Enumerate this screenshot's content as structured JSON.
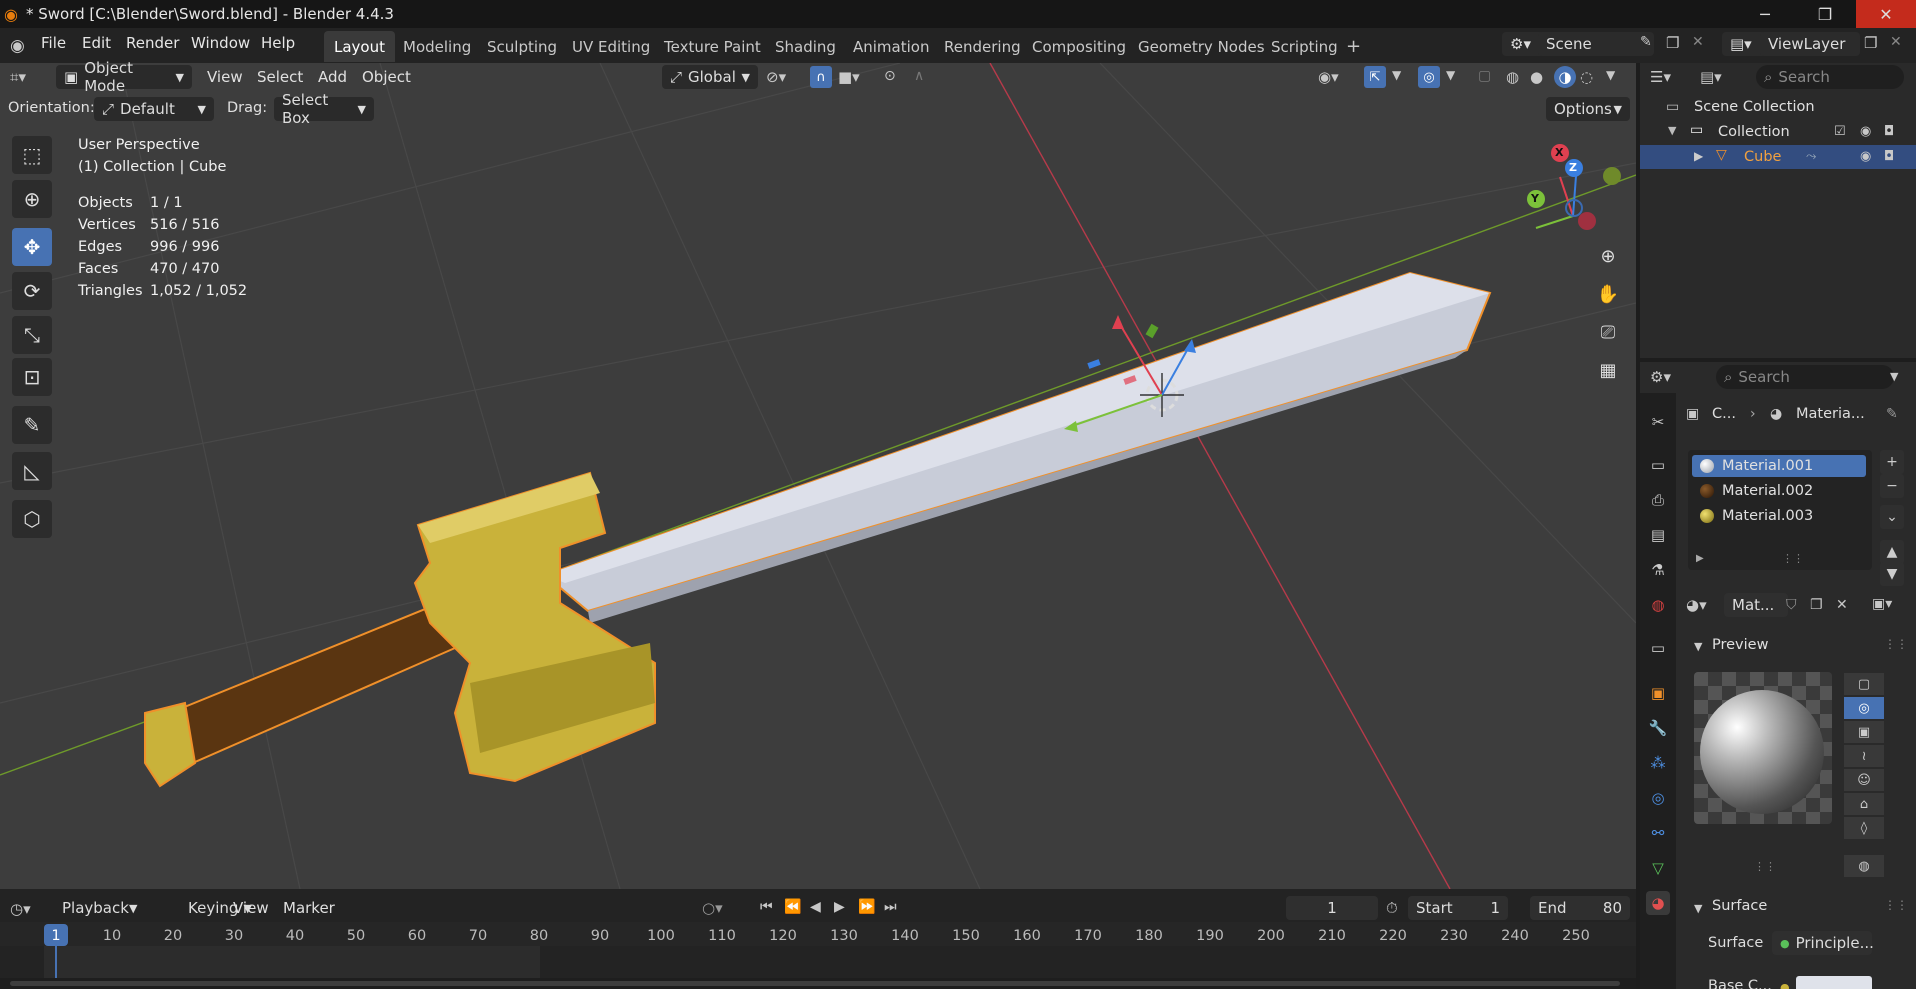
{
  "window": {
    "title": "* Sword [C:\\Blender\\Sword.blend] - Blender 4.4.3",
    "minimize": "─",
    "maximize": "❐",
    "close": "✕"
  },
  "menu": [
    "File",
    "Edit",
    "Render",
    "Window",
    "Help"
  ],
  "workspaces": [
    "Layout",
    "Modeling",
    "Sculpting",
    "UV Editing",
    "Texture Paint",
    "Shading",
    "Animation",
    "Rendering",
    "Compositing",
    "Geometry Nodes",
    "Scripting"
  ],
  "scene": {
    "name": "Scene",
    "view_layer": "ViewLayer"
  },
  "viewport_header": {
    "mode": "Object Mode",
    "menus": [
      "View",
      "Select",
      "Add",
      "Object"
    ],
    "transform": "Global",
    "orientation_label": "Orientation:",
    "orientation_value": "Default",
    "drag_label": "Drag:",
    "drag_value": "Select Box",
    "options": "Options"
  },
  "overlay_info": {
    "perspective": "User Perspective",
    "collection": "(1) Collection | Cube",
    "stats": [
      {
        "label": "Objects",
        "value": "1 / 1"
      },
      {
        "label": "Vertices",
        "value": "516 / 516"
      },
      {
        "label": "Edges",
        "value": "996 / 996"
      },
      {
        "label": "Faces",
        "value": "470 / 470"
      },
      {
        "label": "Triangles",
        "value": "1,052 / 1,052"
      }
    ]
  },
  "gizmo": {
    "x": "X",
    "y": "Y",
    "z": "Z"
  },
  "outliner": {
    "search_placeholder": "Search",
    "scene_collection": "Scene Collection",
    "collection": "Collection",
    "object": "Cube"
  },
  "properties": {
    "search_placeholder": "Search",
    "breadcrumb_object": "C...",
    "breadcrumb_material": "Materia...",
    "materials": [
      "Material.001",
      "Material.002",
      "Material.003"
    ],
    "material_colors": [
      "#b8bcc4",
      "#4a2d12",
      "#c9b23a"
    ],
    "active_material_short": "Mat...",
    "preview_label": "Preview",
    "surface_section": "Surface",
    "surface_label": "Surface",
    "surface_value": "Principle...",
    "base_color_label": "Base C..."
  },
  "timeline": {
    "menus": [
      "Playback",
      "Keying",
      "View",
      "Marker"
    ],
    "current_frame": "1",
    "start_label": "Start",
    "start": "1",
    "end_label": "End",
    "end": "80",
    "ticks": [
      "1",
      "10",
      "20",
      "30",
      "40",
      "50",
      "60",
      "70",
      "80",
      "90",
      "100",
      "110",
      "120",
      "130",
      "140",
      "150",
      "160",
      "170",
      "180",
      "190",
      "200",
      "210",
      "220",
      "230",
      "240",
      "250"
    ]
  },
  "colors": {
    "accent": "#4772b3",
    "selection_outline": "#f0902a",
    "blade": "#c8ccd8",
    "guard": "#c9b23a",
    "handle": "#5a3511",
    "x_axis": "#c0394a",
    "y_axis": "#7cab2a"
  }
}
